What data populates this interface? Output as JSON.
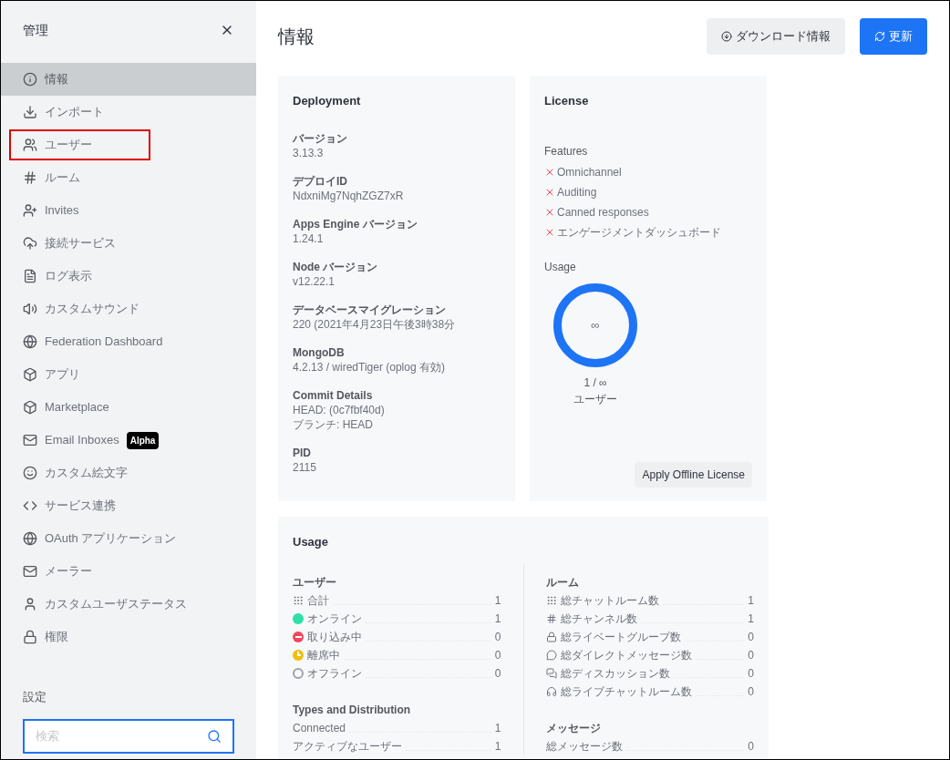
{
  "sidebar": {
    "title": "管理",
    "items": [
      {
        "label": "情報",
        "selected": true,
        "highlighted": false
      },
      {
        "label": "インポート",
        "selected": false,
        "highlighted": false
      },
      {
        "label": "ユーザー",
        "selected": false,
        "highlighted": true
      },
      {
        "label": "ルーム",
        "selected": false,
        "highlighted": false
      },
      {
        "label": "Invites",
        "selected": false,
        "highlighted": false
      },
      {
        "label": "接続サービス",
        "selected": false,
        "highlighted": false
      },
      {
        "label": "ログ表示",
        "selected": false,
        "highlighted": false
      },
      {
        "label": "カスタムサウンド",
        "selected": false,
        "highlighted": false
      },
      {
        "label": "Federation Dashboard",
        "selected": false,
        "highlighted": false
      },
      {
        "label": "アプリ",
        "selected": false,
        "highlighted": false
      },
      {
        "label": "Marketplace",
        "selected": false,
        "highlighted": false
      },
      {
        "label": "Email Inboxes",
        "badge": "Alpha",
        "selected": false,
        "highlighted": false
      },
      {
        "label": "カスタム絵文字",
        "selected": false,
        "highlighted": false
      },
      {
        "label": "サービス連携",
        "selected": false,
        "highlighted": false
      },
      {
        "label": "OAuth アプリケーション",
        "selected": false,
        "highlighted": false
      },
      {
        "label": "メーラー",
        "selected": false,
        "highlighted": false
      },
      {
        "label": "カスタムユーザステータス",
        "selected": false,
        "highlighted": false
      },
      {
        "label": "権限",
        "selected": false,
        "highlighted": false
      }
    ],
    "settings_label": "設定",
    "search": {
      "placeholder": "検索"
    }
  },
  "page": {
    "title": "情報",
    "buttons": [
      {
        "label": "ダウンロード情報",
        "kind": "secondary"
      },
      {
        "label": "更新",
        "kind": "primary"
      }
    ]
  },
  "deployment": {
    "title": "Deployment",
    "fields": [
      {
        "label": "バージョン",
        "values": [
          "3.13.3"
        ]
      },
      {
        "label": "デプロイID",
        "values": [
          "NdxniMg7NqhZGZ7xR"
        ]
      },
      {
        "label": "Apps Engine バージョン",
        "values": [
          "1.24.1"
        ]
      },
      {
        "label": "Node バージョン",
        "values": [
          "v12.22.1"
        ]
      },
      {
        "label": "データベースマイグレーション",
        "values": [
          "220 (2021年4月23日午後3時38分"
        ]
      },
      {
        "label": "MongoDB",
        "values": [
          "4.2.13 / wiredTiger (oplog 有効)"
        ]
      },
      {
        "label": "Commit Details",
        "values": [
          "HEAD: (0c7fbf40d)",
          "ブランチ: HEAD"
        ]
      },
      {
        "label": "PID",
        "values": [
          "2115"
        ]
      }
    ]
  },
  "license": {
    "title": "License",
    "features_label": "Features",
    "features": [
      {
        "label": "Omnichannel",
        "enabled": false
      },
      {
        "label": "Auditing",
        "enabled": false
      },
      {
        "label": "Canned responses",
        "enabled": false
      },
      {
        "label": "エンゲージメントダッシュボード",
        "enabled": false
      }
    ],
    "usage_label": "Usage",
    "donut_center": "∞",
    "donut_caption": "1 / ∞",
    "donut_unit": "ユーザー",
    "button": "Apply Offline License"
  },
  "usage": {
    "title": "Usage",
    "columns": [
      {
        "sections": [
          {
            "label": "ユーザー",
            "rows": [
              {
                "kind": "grid",
                "label": "合計",
                "value": "1"
              },
              {
                "kind": "dot",
                "color": "#2de0a5",
                "label": "オンライン",
                "value": "1"
              },
              {
                "kind": "busy",
                "color": "#f5455c",
                "label": "取り込み中",
                "value": "0"
              },
              {
                "kind": "away",
                "color": "#f3be08",
                "label": "離席中",
                "value": "0"
              },
              {
                "kind": "ring",
                "label": "オフライン",
                "value": "0"
              }
            ]
          },
          {
            "label": "Types and Distribution",
            "rows": [
              {
                "kind": "plain",
                "label": "Connected",
                "value": "1"
              },
              {
                "kind": "plain",
                "label": "アクティブなユーザー",
                "value": "1"
              }
            ]
          }
        ]
      },
      {
        "sections": [
          {
            "label": "ルーム",
            "rows": [
              {
                "kind": "grid",
                "label": "総チャットルーム数",
                "value": "1"
              },
              {
                "kind": "hash",
                "label": "総チャンネル数",
                "value": "1"
              },
              {
                "kind": "lock",
                "label": "総ライベートグループ数",
                "value": "0"
              },
              {
                "kind": "chat",
                "label": "総ダイレクトメッセージ数",
                "value": "0"
              },
              {
                "kind": "discussion",
                "label": "総ディスカッション数",
                "value": "0"
              },
              {
                "kind": "headset",
                "label": "総ライブチャットルーム数",
                "value": "0"
              }
            ]
          },
          {
            "label": "メッセージ",
            "rows": [
              {
                "kind": "plain",
                "label": "総メッセージ数",
                "value": "0"
              }
            ]
          }
        ]
      }
    ]
  }
}
